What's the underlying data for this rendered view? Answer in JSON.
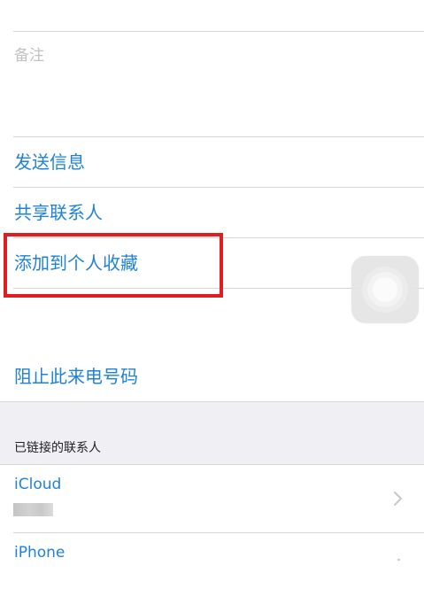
{
  "notes": {
    "label": "备注"
  },
  "actions": {
    "send_message": "发送信息",
    "share_contact": "共享联系人",
    "add_to_favorites": "添加到个人收藏",
    "block_caller": "阻止此来电号码"
  },
  "linked_contacts": {
    "header": "已链接的联系人",
    "items": [
      {
        "label": "iCloud"
      },
      {
        "label": "iPhone"
      }
    ]
  },
  "colors": {
    "accent": "#1f82d6",
    "highlight_border": "#e01e1e",
    "grouped_background": "#efeff4"
  },
  "icons": {
    "disclosure": "chevron-right-icon",
    "assistive_touch": "assistive-touch-icon"
  }
}
